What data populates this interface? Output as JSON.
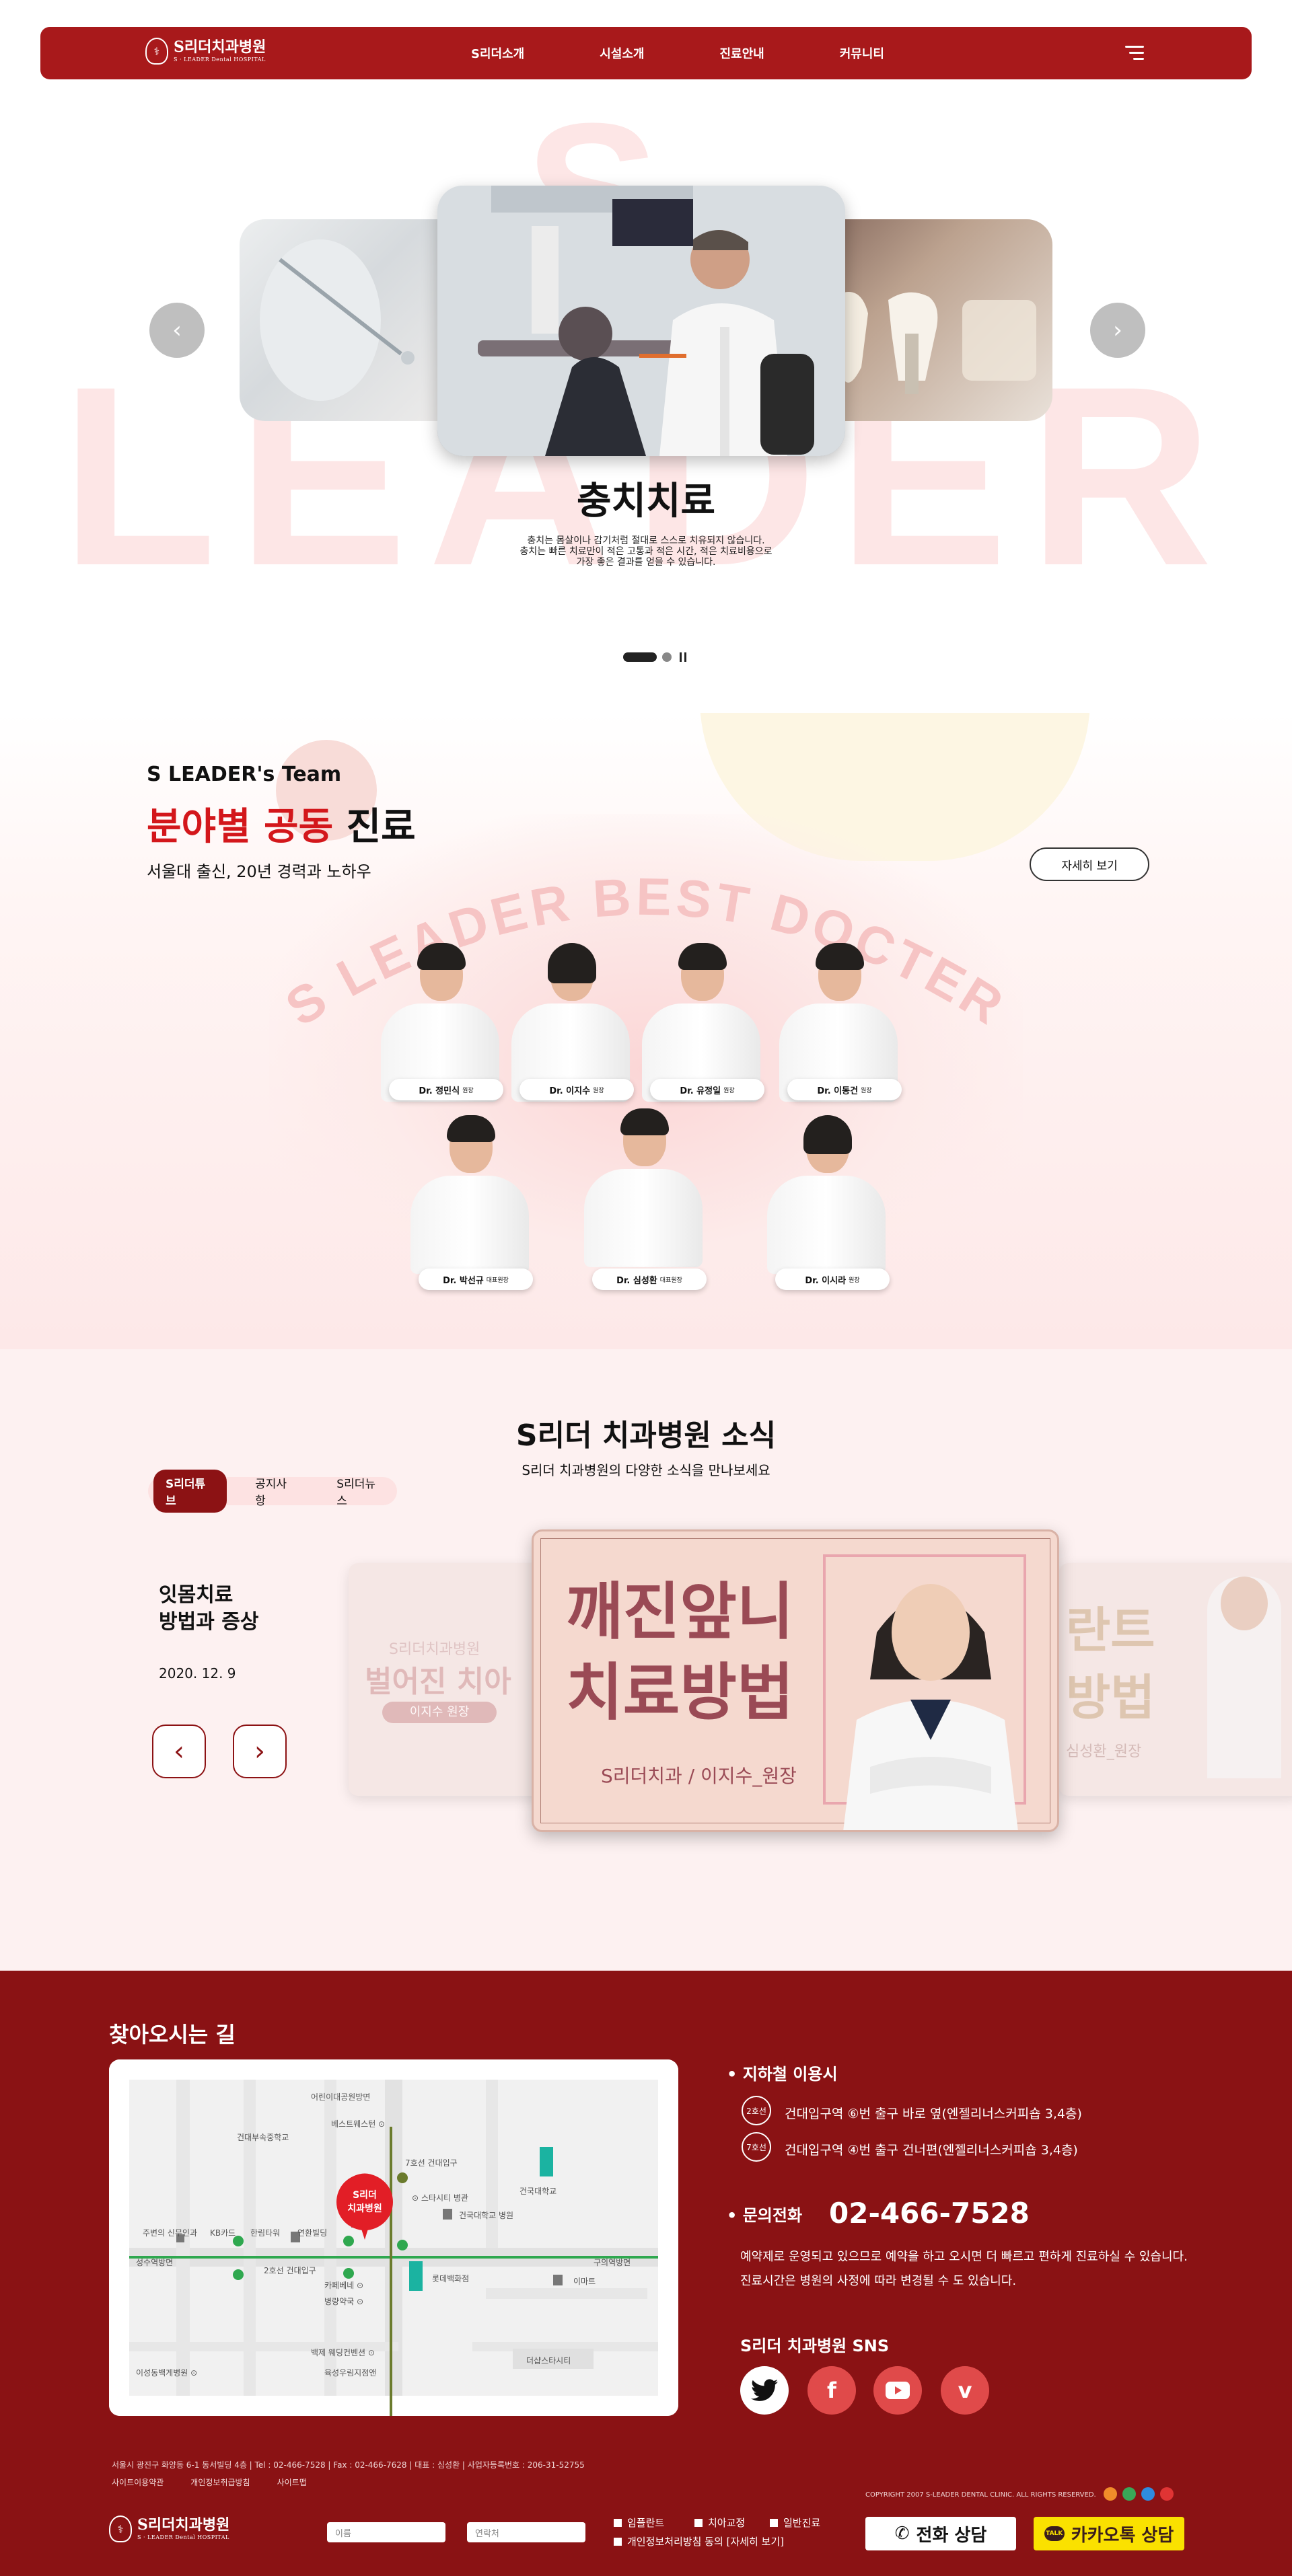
{
  "header": {
    "logo_ko": "S리더치과병원",
    "logo_en": "S · LEADER Dental HOSPITAL",
    "nav": [
      "S리더소개",
      "시설소개",
      "진료안내",
      "커뮤니티"
    ]
  },
  "hero": {
    "bg_text": "LEADER",
    "bg_letter": "S",
    "title": "충치치료",
    "desc": [
      "충치는 몸살이나 감기처럼 절대로 스스로 치유되지 않습니다.",
      "충치는 빠른 치료만이 적은 고통과 적은 시간, 적은 치료비용으로",
      "가장 좋은 결과를 얻을 수 있습니다."
    ]
  },
  "team": {
    "kicker": "S LEADER's Team",
    "title_red": "분야별 공동",
    "title_black": "진료",
    "subtitle": "서울대 출신, 20년 경력과 노하우",
    "more_button": "자세히 보기",
    "arc_text": "S LEADER BEST DOCTER",
    "doctors": [
      {
        "name": "Dr. 정민식",
        "role": "원장"
      },
      {
        "name": "Dr. 이지수",
        "role": "원장"
      },
      {
        "name": "Dr. 유정일",
        "role": "원장"
      },
      {
        "name": "Dr. 이동건",
        "role": "원장"
      },
      {
        "name": "Dr. 박선규",
        "role": "대표원장"
      },
      {
        "name": "Dr. 심성환",
        "role": "대표원장"
      },
      {
        "name": "Dr. 이시라",
        "role": "원장"
      }
    ]
  },
  "news": {
    "title": "S리더 치과병원 소식",
    "subtitle": "S리더 치과병원의 다양한 소식을 만나보세요",
    "tabs": [
      "S리더튜브",
      "공지사항",
      "S리더뉴스"
    ],
    "item_title": [
      "잇몸치료",
      "방법과 증상"
    ],
    "item_date": "2020. 12. 9",
    "prev_icon": "chevron-left-icon",
    "next_icon": "chevron-right-icon",
    "card_main": {
      "line1": "깨진앞니",
      "line2": "치료방법",
      "caption": "S리더치과 / 이지수_원장"
    },
    "card_left": {
      "line0": "S리더치과병원",
      "line1": "벌어진 치아",
      "badge": "이지수 원장"
    },
    "card_right": {
      "line1": "란트",
      "line2": "방법",
      "caption": "심성환_원장"
    }
  },
  "location": {
    "title": "찾아오시는 길",
    "map_pin": [
      "S리더",
      "치과병원"
    ],
    "map_labels": [
      "어린이대공원방면",
      "건대부속중학교",
      "베스트웨스턴 ⊙",
      "7호선 건대입구",
      "건국대학교",
      "⊙ 스타시티 병관",
      "건국대학교 병원",
      "주변의 신무인과",
      "KB카드",
      "한림타워",
      "연환빌딩",
      "성수역방면",
      "2호선 건대입구",
      "구의역방면",
      "롯데백화점",
      "이마트",
      "카페베네 ⊙",
      "병량약국 ⊙",
      "백제 웨딩컨벤션 ⊙",
      "이성동백게병원 ⊙",
      "육성우림지점앤",
      "더샵스타시티"
    ],
    "subway_head": "지하철 이용시",
    "subway": [
      {
        "line": "2호선",
        "text": "건대입구역 ⑥번 출구 바로 옆(엔젤리너스커피숍 3,4층)"
      },
      {
        "line": "7호선",
        "text": "건대입구역 ④번 출구 건너편(엔젤리너스커피숍 3,4층)"
      }
    ],
    "phone_head": "문의전화",
    "phone": "02-466-7528",
    "phone_note": [
      "예약제로 운영되고 있으므로 예약을 하고 오시면 더 빠르고 편하게 진료하실 수 있습니다.",
      "진료시간은 병원의 사정에 따라 변경될 수 도 있습니다."
    ],
    "sns_title": "S리더 치과병원 SNS",
    "sns": [
      "twitter-icon",
      "facebook-icon",
      "youtube-icon",
      "vimeo-icon"
    ]
  },
  "footer": {
    "info": "서울시 광진구 화양동 6-1 동서빌딩 4층  |  Tel : 02-466-7528  |  Fax : 02-466-7628  |  대표 : 심성환  |  사업자등록번호 : 206-31-52755",
    "links": [
      "사이트이용약관",
      "개인정보취급방침",
      "사이트맵"
    ],
    "copyright": "COPYRIGHT 2007 S-LEADER DENTAL CLINIC. ALL RIGHTS RESERVED.",
    "name_placeholder": "이름",
    "phone_placeholder": "연락처",
    "checks": [
      "임플란트",
      "치아교정",
      "일반진료"
    ],
    "privacy": "개인정보처리방침 동의 [자세히 보기]",
    "call_button": "전화 상담",
    "kakao_button": "카카오톡 상담"
  },
  "colors": {
    "brand": "#a8191b",
    "brand_dark": "#8a1214",
    "accent_red": "#d3171b",
    "kakao": "#fae100"
  }
}
